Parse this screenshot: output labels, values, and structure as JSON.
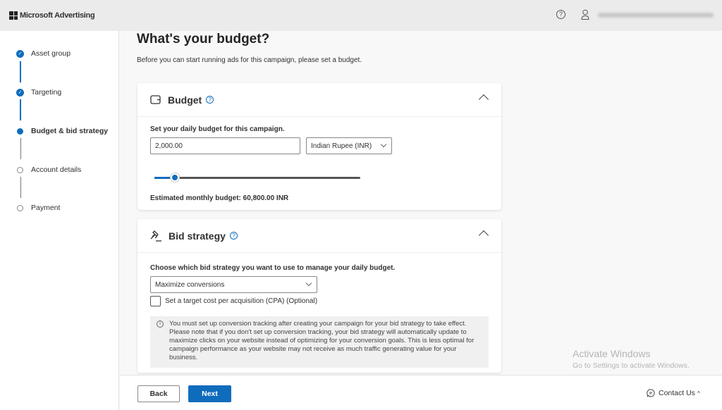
{
  "header": {
    "app_title": "Microsoft Advertising",
    "help_icon": "question-circle-icon",
    "user_icon": "person-icon"
  },
  "steps": [
    {
      "label": "Asset group",
      "state": "complete"
    },
    {
      "label": "Targeting",
      "state": "complete"
    },
    {
      "label": "Budget & bid strategy",
      "state": "current"
    },
    {
      "label": "Account details",
      "state": "pending"
    },
    {
      "label": "Payment",
      "state": "pending"
    }
  ],
  "page": {
    "title": "What's your budget?",
    "subtitle": "Before you can start running ads for this campaign, please set a budget."
  },
  "budget": {
    "title": "Budget",
    "prompt": "Set your daily budget for this campaign.",
    "amount": "2,000.00",
    "currency": "Indian Rupee (INR)",
    "slider_percent": 10,
    "estimate": "Estimated monthly budget: 60,800.00 INR"
  },
  "bid": {
    "title": "Bid strategy",
    "prompt": "Choose which bid strategy you want to use to manage your daily budget.",
    "strategy": "Maximize conversions",
    "cpa_label": "Set a target cost per acquisition (CPA) (Optional)",
    "cpa_checked": false,
    "info": "You must set up conversion tracking after creating your campaign for your bid strategy to take effect. Please note that if you don't set up conversion tracking, your bid strategy will automatically update to maximize clicks on your website instead of optimizing for your conversion goals. This is less optimal for campaign performance as your website may not receive as much traffic generating value for your business."
  },
  "footer": {
    "back": "Back",
    "next": "Next",
    "contact": "Contact Us"
  },
  "watermark": {
    "title": "Activate Windows",
    "subtitle": "Go to Settings to activate Windows."
  },
  "colors": {
    "accent": "#0f6cbd"
  }
}
